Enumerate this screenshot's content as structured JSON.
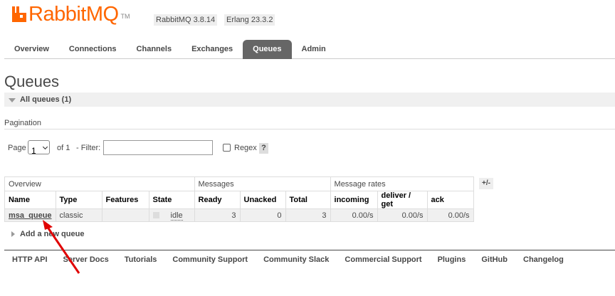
{
  "header": {
    "logo_text": "RabbitMQ",
    "logo_tm": "TM",
    "version": "RabbitMQ 3.8.14",
    "erlang": "Erlang 23.3.2",
    "brand_color": "#ff6600"
  },
  "tabs": [
    {
      "label": "Overview"
    },
    {
      "label": "Connections"
    },
    {
      "label": "Channels"
    },
    {
      "label": "Exchanges"
    },
    {
      "label": "Queues",
      "active": true
    },
    {
      "label": "Admin"
    }
  ],
  "page": {
    "title": "Queues",
    "section": "All queues (1)",
    "pagination_label": "Pagination"
  },
  "controls": {
    "page_label": "Page",
    "page_value": "1",
    "of_label": "of 1",
    "filter_label": "- Filter:",
    "filter_value": "",
    "regex_label": "Regex",
    "help": "?"
  },
  "table": {
    "groups": {
      "overview": "Overview",
      "messages": "Messages",
      "rates": "Message rates"
    },
    "columns": [
      "Name",
      "Type",
      "Features",
      "State",
      "Ready",
      "Unacked",
      "Total",
      "incoming",
      "deliver / get",
      "ack"
    ],
    "toggle": "+/-",
    "rows": [
      {
        "name": "msa_queue",
        "type": "classic",
        "features": "",
        "state": "idle",
        "ready": "3",
        "unacked": "0",
        "total": "3",
        "incoming": "0.00/s",
        "deliver_get": "0.00/s",
        "ack": "0.00/s"
      }
    ]
  },
  "add_queue": "Add a new queue",
  "footer": {
    "links": [
      "HTTP API",
      "Server Docs",
      "Tutorials",
      "Community Support",
      "Community Slack",
      "Commercial Support",
      "Plugins",
      "GitHub",
      "Changelog"
    ]
  },
  "annotation": {
    "arrow_color": "#e00000"
  }
}
